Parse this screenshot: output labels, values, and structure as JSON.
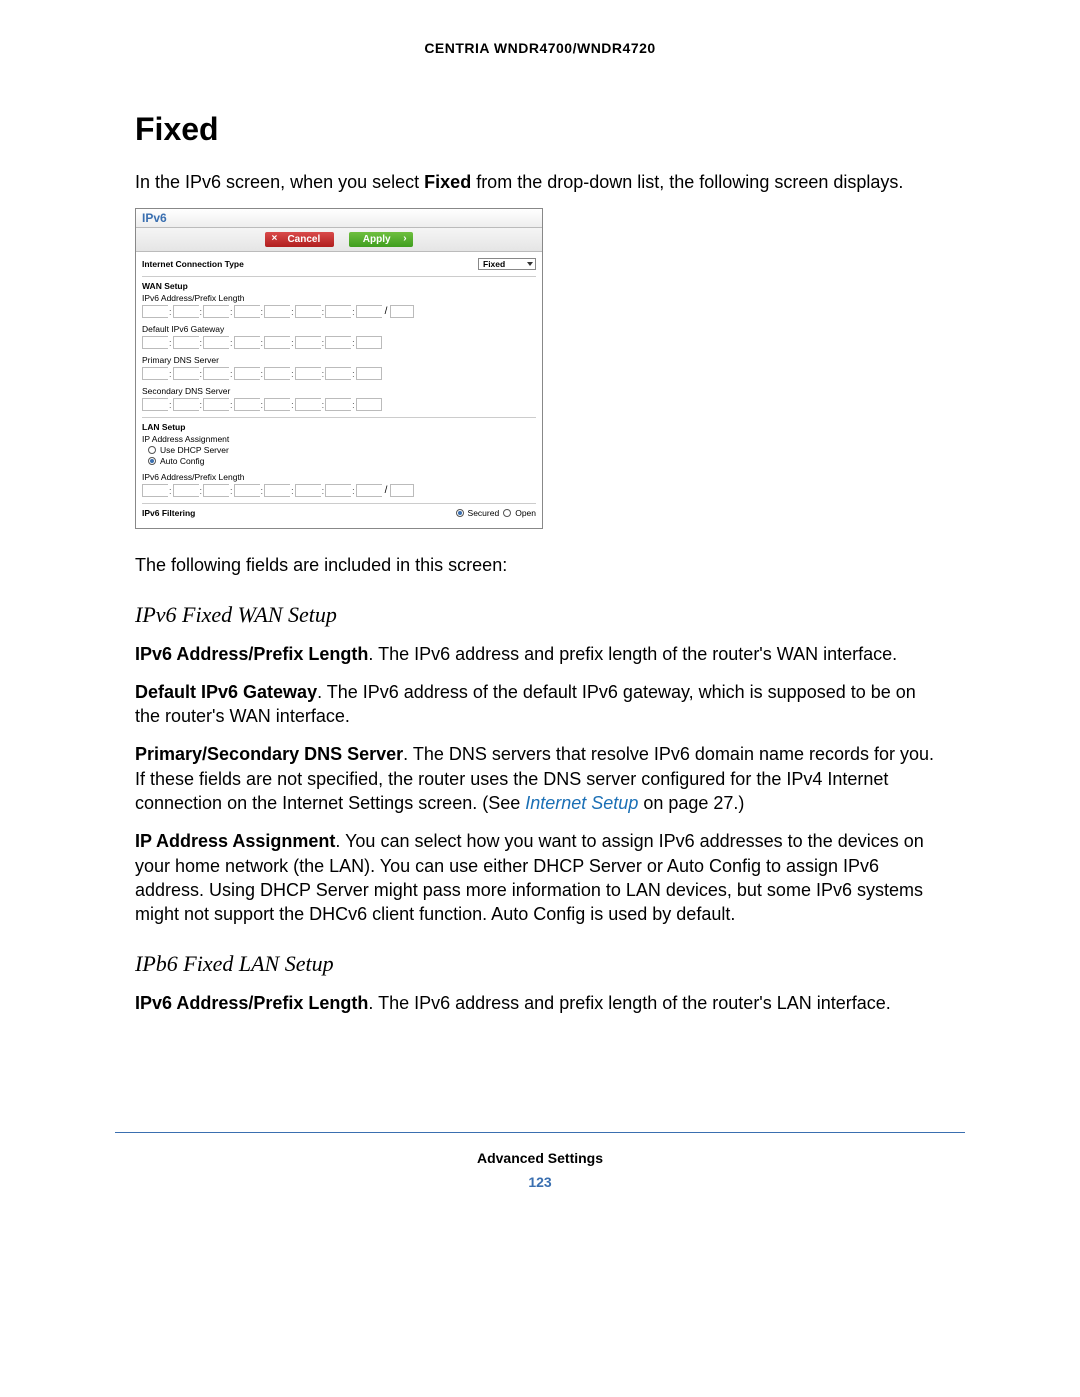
{
  "header": "CENTRIA WNDR4700/WNDR4720",
  "title": "Fixed",
  "intro_before_bold": "In the IPv6 screen, when you select ",
  "intro_bold": "Fixed",
  "intro_after_bold": " from the drop-down list, the following screen displays.",
  "screenshot": {
    "title": "IPv6",
    "cancel": "Cancel",
    "apply": "Apply",
    "conn_type_label": "Internet Connection Type",
    "conn_type_value": "Fixed",
    "wan_setup": "WAN Setup",
    "ipv6_addr_prefix": "IPv6 Address/Prefix Length",
    "default_gw": "Default IPv6 Gateway",
    "primary_dns": "Primary DNS Server",
    "secondary_dns": "Secondary DNS Server",
    "lan_setup": "LAN Setup",
    "ip_assignment": "IP Address Assignment",
    "use_dhcp": "Use DHCP Server",
    "auto_config": "Auto Config",
    "ipv6_filtering": "IPv6 Filtering",
    "secured": "Secured",
    "open": "Open"
  },
  "after_screenshot": "The following fields are included in this screen:",
  "section_wan": "IPv6 Fixed WAN Setup",
  "para1_bold": "IPv6 Address/Prefix Length",
  "para1_rest": ". The IPv6 address and prefix length of the router's WAN interface.",
  "para2_bold": "Default IPv6 Gateway",
  "para2_rest": ". The IPv6 address of the default IPv6 gateway, which is supposed to be on the router's WAN interface.",
  "para3_bold": "Primary/Secondary DNS Server",
  "para3_rest_a": ". The DNS servers that resolve IPv6 domain name records for you. If these fields are not specified, the router uses the DNS server configured for the IPv4 Internet connection on the Internet Settings screen. (See ",
  "para3_link": "Internet Setup",
  "para3_rest_b": " on page 27.)",
  "para4_bold": "IP Address Assignment",
  "para4_rest": ". You can select how you want to assign IPv6 addresses to the devices on your home network (the LAN). You can use either DHCP Server or Auto Config to assign IPv6 address. Using DHCP Server might pass more information to LAN devices, but some IPv6 systems might not support the DHCv6 client function. Auto Config is used by default.",
  "section_lan": "IPb6 Fixed LAN Setup",
  "para5_bold": "IPv6 Address/Prefix Length",
  "para5_rest": ". The IPv6 address and prefix length of the router's LAN interface.",
  "footer_label": "Advanced Settings",
  "page_number": "123"
}
